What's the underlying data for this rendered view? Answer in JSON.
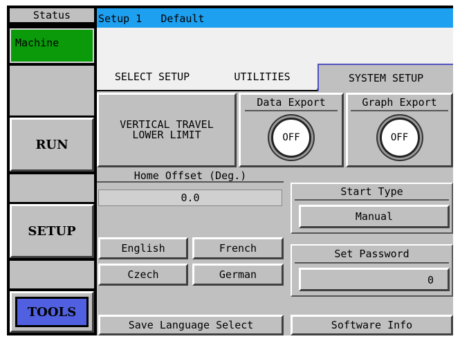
{
  "status": {
    "label": "Status",
    "machine": "Machine"
  },
  "header": {
    "setup": "Setup 1",
    "profile": "Default"
  },
  "tabs": {
    "select_setup": "SELECT SETUP",
    "utilities": "UTILITIES",
    "system_setup": "SYSTEM SETUP"
  },
  "nav": {
    "run": "RUN",
    "setup": "SETUP",
    "tools": "TOOLS"
  },
  "buttons": {
    "vertical_travel_line1": "VERTICAL TRAVEL",
    "vertical_travel_line2": "LOWER LIMIT",
    "data_export": "Data Export",
    "graph_export": "Graph Export",
    "toggle_off": "OFF"
  },
  "home_offset": {
    "label": "Home Offset (Deg.)",
    "value": "0.0"
  },
  "start_type": {
    "label": "Start Type",
    "value": "Manual"
  },
  "languages": {
    "english": "English",
    "french": "French",
    "czech": "Czech",
    "german": "German",
    "save": "Save Language Select"
  },
  "password": {
    "label": "Set Password",
    "value": "0"
  },
  "software_info": "Software Info",
  "colors": {
    "header_bar": "#1ea0f0",
    "machine_status": "#0a9a0a",
    "tools_button": "#5060e0",
    "panel_gray": "#c0c0c0"
  }
}
